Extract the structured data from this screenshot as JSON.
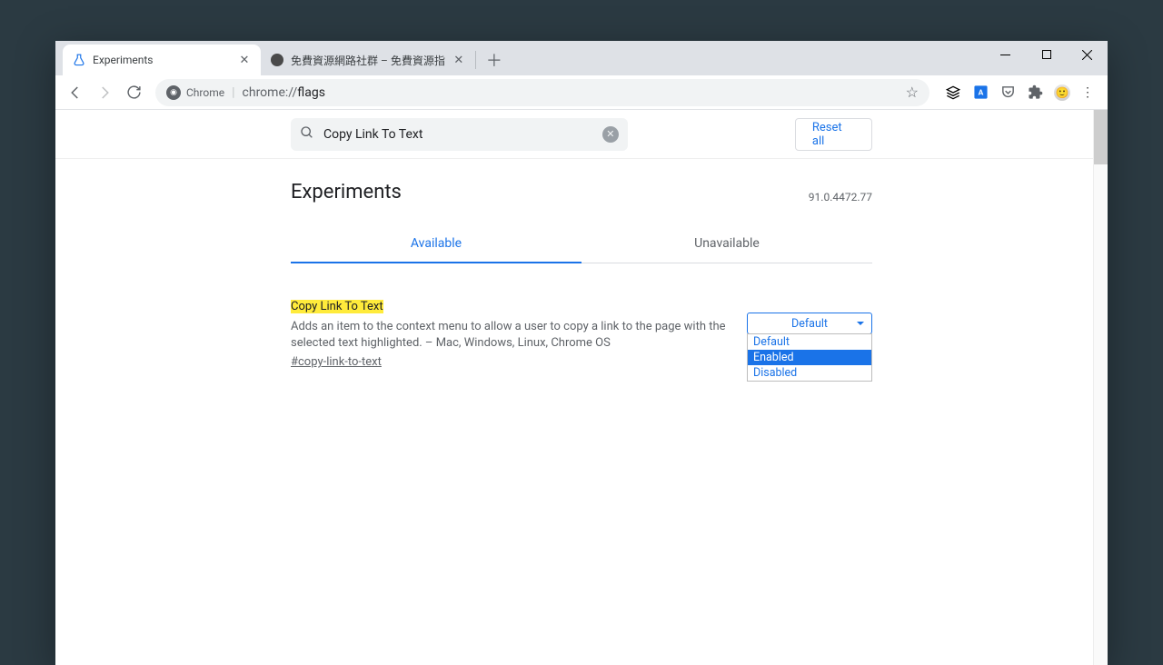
{
  "tabs": [
    {
      "title": "Experiments",
      "active": true
    },
    {
      "title": "免費資源網路社群 – 免費資源指",
      "active": false
    }
  ],
  "omnibox": {
    "label": "Chrome",
    "url_prefix": "chrome://",
    "url_path": "flags"
  },
  "search": {
    "value": "Copy Link To Text"
  },
  "reset_label": "Reset all",
  "page_title": "Experiments",
  "version": "91.0.4472.77",
  "tabs2": {
    "available": "Available",
    "unavailable": "Unavailable"
  },
  "flag": {
    "title": "Copy Link To Text",
    "desc": "Adds an item to the context menu to allow a user to copy a link to the page with the selected text highlighted. – Mac, Windows, Linux, Chrome OS",
    "anchor": "#copy-link-to-text",
    "select_value": "Default",
    "options": [
      "Default",
      "Enabled",
      "Disabled"
    ]
  }
}
